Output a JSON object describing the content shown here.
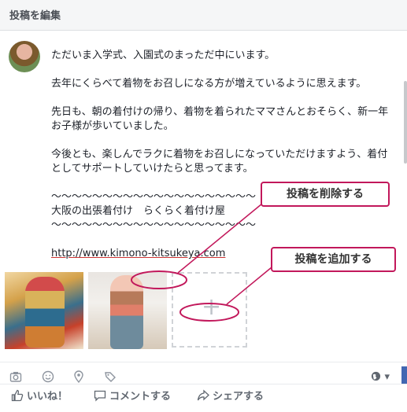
{
  "header": {
    "title": "投稿を編集"
  },
  "post": {
    "paragraphs": [
      "ただいま入学式、入園式のまっただ中にいます。",
      "去年にくらべて着物をお召しになる方が増えているように思えます。",
      "先日も、朝の着付けの帰り、着物を着られたママさんとおそらく、新一年",
      "お子様が歩いていました。",
      "今後とも、楽しんでラクに着物をお召しになっていただけますよう、着付",
      "としてサポートしていけたらと思ってます。",
      "〜〜〜〜〜〜〜〜〜〜〜〜〜〜〜〜〜〜〜〜",
      "大阪の出張着付け　らくらく着付け屋",
      "〜〜〜〜〜〜〜〜〜〜〜〜〜〜〜〜〜〜〜〜",
      "http://www.kimono-kitsukeya.com"
    ]
  },
  "annotations": {
    "delete": "投稿を削除する",
    "add": "投稿を追加する",
    "accent_color": "#c2185b"
  },
  "toolbar": {
    "icons": [
      "camera-icon",
      "smiley-icon",
      "location-pin-icon",
      "tag-icon"
    ],
    "privacy_icon": "globe-icon",
    "privacy_caret": "▾"
  },
  "actions": {
    "like": "いいね！",
    "comment": "コメントする",
    "share": "シェアする"
  },
  "colors": {
    "brand": "#4267b2",
    "header_bg": "#f5f6f7"
  }
}
